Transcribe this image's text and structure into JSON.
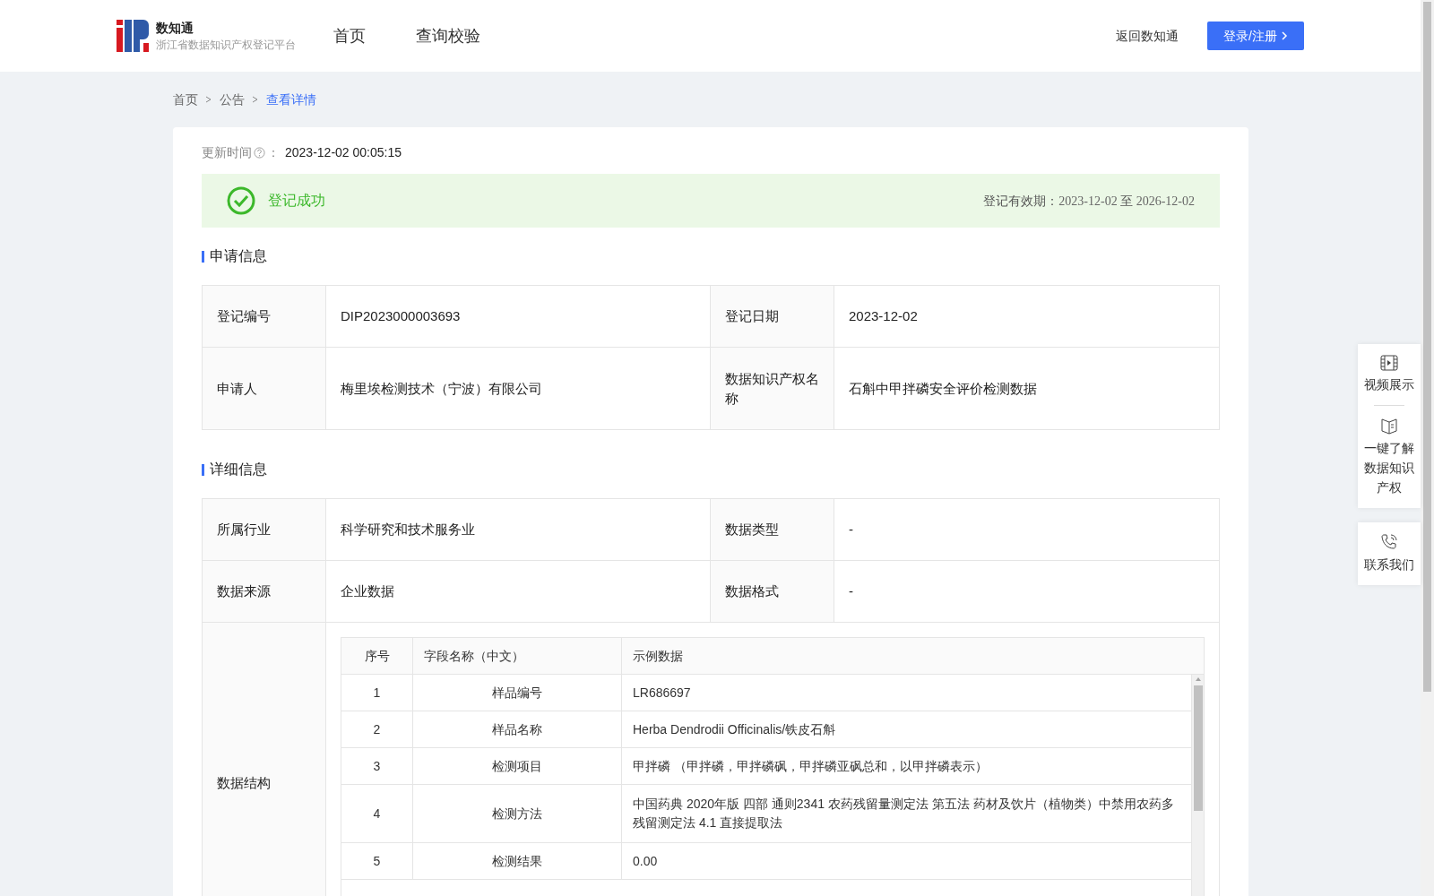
{
  "header": {
    "logo_title": "数知通",
    "logo_subtitle": "浙江省数据知识产权登记平台",
    "nav": [
      {
        "label": "首页",
        "selected": false
      },
      {
        "label": "查询校验",
        "selected": false
      }
    ],
    "back_link": "返回数知通",
    "login_button": "登录/注册"
  },
  "breadcrumb": [
    {
      "label": "首页",
      "current": false
    },
    {
      "label": "公告",
      "current": false
    },
    {
      "label": "查看详情",
      "current": true
    }
  ],
  "update_time": {
    "label": "更新时间",
    "separator": "：",
    "value": "2023-12-02 00:05:15"
  },
  "status_banner": {
    "text": "登记成功",
    "validity_label": "登记有效期：",
    "validity_start": "2023-12-02",
    "validity_sep": "至",
    "validity_end": "2026-12-02"
  },
  "application_info": {
    "title": "申请信息",
    "rows": [
      {
        "label_1": "登记编号",
        "value_1": "DIP2023000003693",
        "label_2": "登记日期",
        "value_2": "2023-12-02"
      },
      {
        "label_1": "申请人",
        "value_1": "梅里埃检测技术（宁波）有限公司",
        "label_2": "数据知识产权名称",
        "value_2": "石斛中甲拌磷安全评价检测数据"
      }
    ]
  },
  "detail_info": {
    "title": "详细信息",
    "rows": [
      {
        "label_1": "所属行业",
        "value_1": "科学研究和技术服务业",
        "label_2": "数据类型",
        "value_2": "-"
      },
      {
        "label_1": "数据来源",
        "value_1": "企业数据",
        "label_2": "数据格式",
        "value_2": "-"
      }
    ],
    "structure_label": "数据结构",
    "structure_table": {
      "columns": [
        "序号",
        "字段名称（中文）",
        "示例数据"
      ],
      "rows": [
        [
          "1",
          "样品编号",
          "LR686697"
        ],
        [
          "2",
          "样品名称",
          "Herba Dendrodii Officinalis/铁皮石斛"
        ],
        [
          "3",
          "检测项目",
          "甲拌磷 （甲拌磷，甲拌磷砜，甲拌磷亚砜总和，以甲拌磷表示）"
        ],
        [
          "4",
          "检测方法",
          "中国药典 2020年版 四部 通则2341 农药残留量测定法 第五法 药材及饮片（植物类）中禁用农药多残留测定法 4.1 直接提取法"
        ],
        [
          "5",
          "检测结果",
          "0.00"
        ]
      ]
    }
  },
  "side_panel": [
    {
      "kind": "video",
      "label": "视频展示"
    },
    {
      "kind": "book",
      "label": "一键了解数据知识产权"
    },
    {
      "kind": "phone",
      "label": "联系我们"
    }
  ]
}
